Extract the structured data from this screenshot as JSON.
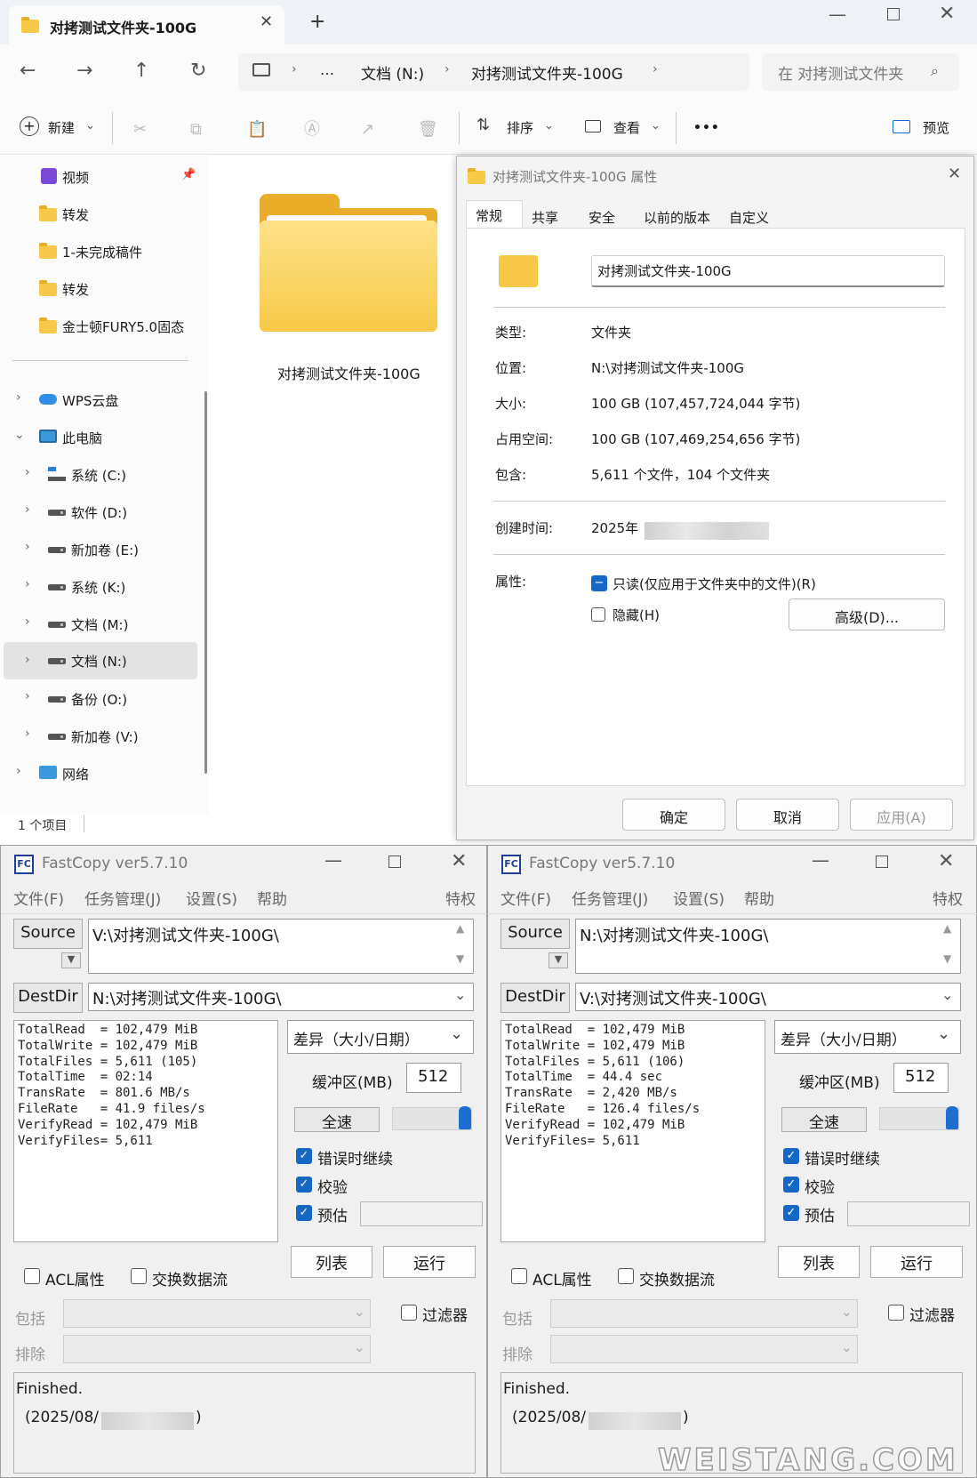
{
  "explorer": {
    "tab_title": "对拷测试文件夹-100G",
    "breadcrumb": [
      "…",
      "文档 (N:)",
      "对拷测试文件夹-100G"
    ],
    "search_placeholder": "在 对拷测试文件夹",
    "toolbar": {
      "new": "新建",
      "sort": "排序",
      "view": "查看",
      "more": "•••",
      "preview": "预览"
    },
    "quick_access": [
      "视频",
      "转发",
      "1-未完成稿件",
      "转发",
      "金士顿FURY5.0固态"
    ],
    "tree": {
      "wps": "WPS云盘",
      "pc": "此电脑",
      "drives": [
        "系统 (C:)",
        "软件 (D:)",
        "新加卷 (E:)",
        "系统 (K:)",
        "文档 (M:)",
        "文档 (N:)",
        "备份 (O:)",
        "新加卷 (V:)"
      ],
      "network": "网络"
    },
    "folder_name": "对拷测试文件夹-100G",
    "status": "1 个项目"
  },
  "props": {
    "title": "对拷测试文件夹-100G 属性",
    "tabs": [
      "常规",
      "共享",
      "安全",
      "以前的版本",
      "自定义"
    ],
    "name_value": "对拷测试文件夹-100G",
    "rows": [
      {
        "label": "类型:",
        "value": "文件夹"
      },
      {
        "label": "位置:",
        "value": "N:\\对拷测试文件夹-100G"
      },
      {
        "label": "大小:",
        "value": "100 GB (107,457,724,044 字节)"
      },
      {
        "label": "占用空间:",
        "value": "100 GB (107,469,254,656 字节)"
      },
      {
        "label": "包含:",
        "value": "5,611 个文件，104 个文件夹"
      }
    ],
    "created_label": "创建时间:",
    "created_value": "2025年",
    "attr_label": "属性:",
    "readonly": "只读(仅应用于文件夹中的文件)(R)",
    "hidden": "隐藏(H)",
    "advanced": "高级(D)...",
    "ok": "确定",
    "cancel": "取消",
    "apply": "应用(A)"
  },
  "fastcopy": [
    {
      "title": "FastCopy ver5.7.10",
      "menu": [
        "文件(F)",
        "任务管理(J)",
        "设置(S)",
        "帮助"
      ],
      "privilege": "特权",
      "source_btn": "Source",
      "source_path": "V:\\对拷测试文件夹-100G\\",
      "dest_btn": "DestDir",
      "dest_path": "N:\\对拷测试文件夹-100G\\",
      "stats": "TotalRead  = 102,479 MiB\nTotalWrite = 102,479 MiB\nTotalFiles = 5,611 (105)\nTotalTime  = 02:14\nTransRate  = 801.6 MB/s\nFileRate   = 41.9 files/s\nVerifyRead = 102,479 MiB\nVerifyFiles= 5,611",
      "mode": "差异（大小/日期）",
      "buffer_label": "缓冲区(MB)",
      "buffer_value": "512",
      "speed_btn": "全速",
      "opt_continue": "错误时继续",
      "opt_verify": "校验",
      "opt_estimate": "预估",
      "list_btn": "列表",
      "run_btn": "运行",
      "acl": "ACL属性",
      "ads": "交换数据流",
      "include": "包括",
      "exclude": "排除",
      "filter": "过滤器",
      "log_line1": "Finished.",
      "log_line2": "(2025/08/"
    },
    {
      "title": "FastCopy ver5.7.10",
      "menu": [
        "文件(F)",
        "任务管理(J)",
        "设置(S)",
        "帮助"
      ],
      "privilege": "特权",
      "source_btn": "Source",
      "source_path": "N:\\对拷测试文件夹-100G\\",
      "dest_btn": "DestDir",
      "dest_path": "V:\\对拷测试文件夹-100G\\",
      "stats": "TotalRead  = 102,479 MiB\nTotalWrite = 102,479 MiB\nTotalFiles = 5,611 (106)\nTotalTime  = 44.4 sec\nTransRate  = 2,420 MB/s\nFileRate   = 126.4 files/s\nVerifyRead = 102,479 MiB\nVerifyFiles= 5,611",
      "mode": "差异（大小/日期）",
      "buffer_label": "缓冲区(MB)",
      "buffer_value": "512",
      "speed_btn": "全速",
      "opt_continue": "错误时继续",
      "opt_verify": "校验",
      "opt_estimate": "预估",
      "list_btn": "列表",
      "run_btn": "运行",
      "acl": "ACL属性",
      "ads": "交换数据流",
      "include": "包括",
      "exclude": "排除",
      "filter": "过滤器",
      "log_line1": "Finished.",
      "log_line2": "(2025/08/"
    }
  ],
  "watermark": "WEISTANG.COM"
}
